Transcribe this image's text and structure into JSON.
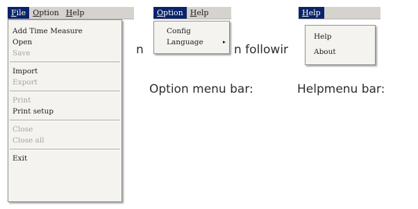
{
  "file_menu": {
    "menubar": [
      {
        "key": "F",
        "rest": "ile"
      },
      {
        "key": "O",
        "rest": "ption"
      },
      {
        "key": "H",
        "rest": "elp"
      }
    ],
    "items": {
      "add_time_measure": "Add Time Measure",
      "open": "Open",
      "save": "Save",
      "import": "Import",
      "export": "Export",
      "print": "Print",
      "print_setup": "Print setup",
      "close": "Close",
      "close_all": "Close all",
      "exit": "Exit"
    }
  },
  "option_menu": {
    "menubar": [
      {
        "key": "O",
        "rest": "ption"
      },
      {
        "key": "H",
        "rest": "elp"
      }
    ],
    "items": {
      "config": "Config",
      "language": "Language"
    },
    "submenu_arrow": "▸"
  },
  "help_menu": {
    "menubar": [
      {
        "key": "H",
        "rest": "elp"
      }
    ],
    "items": {
      "help": "Help",
      "about": "About"
    }
  },
  "background_text": {
    "line1_left": "n",
    "line1_right": "n followir",
    "option_caption": "Option menu bar:",
    "help_caption": "Helpmenu bar:"
  }
}
